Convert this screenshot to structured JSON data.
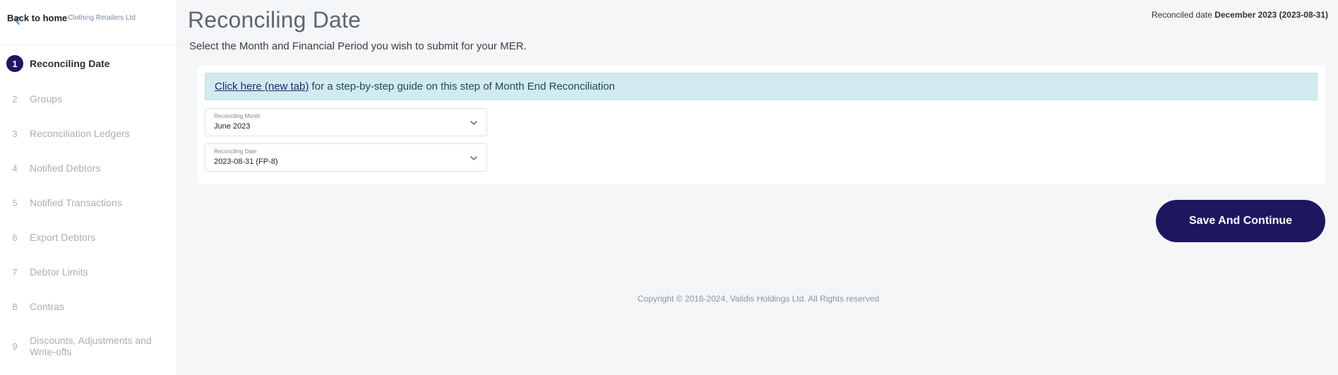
{
  "sidebar": {
    "back_label": "Back to home",
    "company": "Clothing Retailers Ltd",
    "steps": [
      {
        "num": "1",
        "label": "Reconciling Date"
      },
      {
        "num": "2",
        "label": "Groups"
      },
      {
        "num": "3",
        "label": "Reconciliation Ledgers"
      },
      {
        "num": "4",
        "label": "Notified Debtors"
      },
      {
        "num": "5",
        "label": "Notified Transactions"
      },
      {
        "num": "6",
        "label": "Export Debtors"
      },
      {
        "num": "7",
        "label": "Debtor Limits"
      },
      {
        "num": "8",
        "label": "Contras"
      },
      {
        "num": "9",
        "label": "Discounts, Adjustments and Write-offs"
      }
    ]
  },
  "header": {
    "title": "Reconciling Date",
    "reconciled_prefix": "Reconciled date",
    "reconciled_value": "December 2023 (2023-08-31)",
    "subtitle": "Select the Month and Financial Period you wish to submit for your MER."
  },
  "guide": {
    "link_text": "Click here (new tab)",
    "rest_text": " for a step-by-step guide on this step of Month End Reconciliation"
  },
  "fields": {
    "month": {
      "label": "Reconciling Month",
      "value": "June 2023"
    },
    "date": {
      "label": "Reconciling Date",
      "value": "2023-08-31 (FP-8)"
    }
  },
  "actions": {
    "save_label": "Save And Continue"
  },
  "footer": {
    "copyright": "Copyright © 2016-2024, Validis Holdings Ltd. All Rights reserved"
  },
  "colors": {
    "primary": "#1e1760",
    "banner_bg": "#d1ebf0"
  }
}
